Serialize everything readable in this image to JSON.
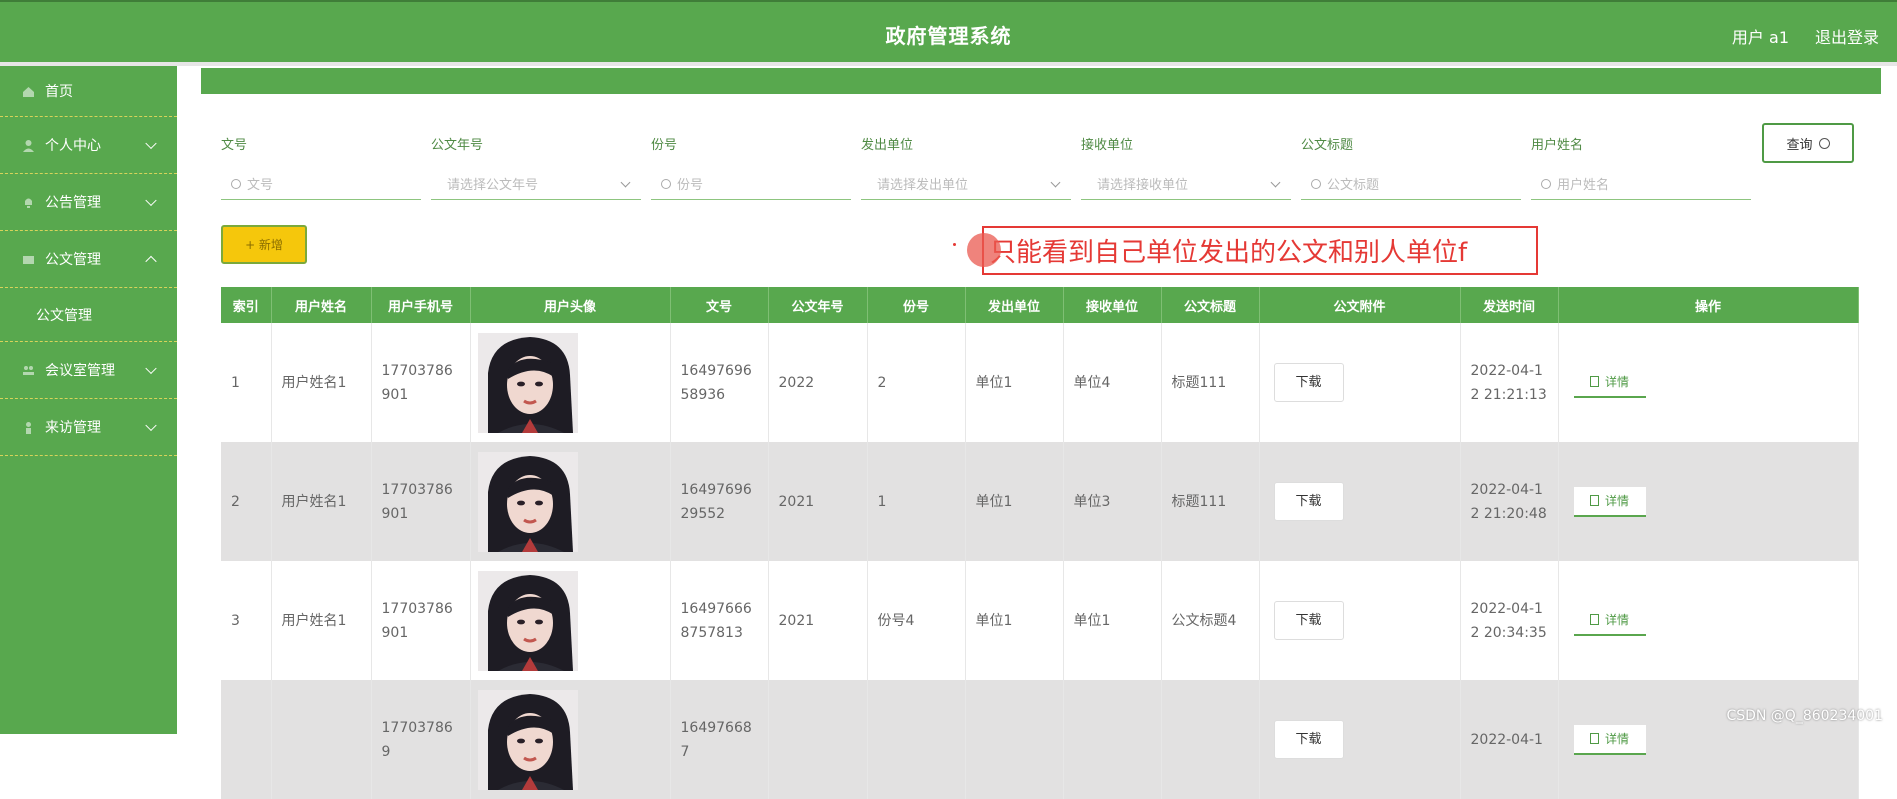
{
  "header": {
    "title": "政府管理系统",
    "user": "用户 a1",
    "logout": "退出登录"
  },
  "sidebar": {
    "items": [
      {
        "label": "首页"
      },
      {
        "label": "个人中心"
      },
      {
        "label": "公告管理"
      },
      {
        "label": "公文管理"
      },
      {
        "label": "公文管理"
      },
      {
        "label": "会议室管理"
      },
      {
        "label": "来访管理"
      }
    ]
  },
  "filters": {
    "wenhao": {
      "label": "文号",
      "placeholder": "文号"
    },
    "year": {
      "label": "公文年号",
      "placeholder": "请选择公文年号"
    },
    "fenhao": {
      "label": "份号",
      "placeholder": "份号"
    },
    "sender": {
      "label": "发出单位",
      "placeholder": "请选择发出单位"
    },
    "receiver": {
      "label": "接收单位",
      "placeholder": "请选择接收单位"
    },
    "title": {
      "label": "公文标题",
      "placeholder": "公文标题"
    },
    "username": {
      "label": "用户姓名",
      "placeholder": "用户姓名"
    },
    "query": "查询",
    "add": "+ 新增"
  },
  "annotation": "只能看到自己单位发出的公文和别人单位f",
  "table": {
    "headers": [
      "索引",
      "用户姓名",
      "用户手机号",
      "用户头像",
      "文号",
      "公文年号",
      "份号",
      "发出单位",
      "接收单位",
      "公文标题",
      "公文附件",
      "发送时间",
      "操作"
    ],
    "download": "下载",
    "detail": "详情",
    "rows": [
      {
        "idx": "1",
        "name": "用户姓名1",
        "phone": "17703786901",
        "wenhao": "1649769658936",
        "year": "2022",
        "fenhao": "2",
        "sender": "单位1",
        "receiver": "单位4",
        "title": "标题111",
        "time": "2022-04-12 21:21:13"
      },
      {
        "idx": "2",
        "name": "用户姓名1",
        "phone": "17703786901",
        "wenhao": "1649769629552",
        "year": "2021",
        "fenhao": "1",
        "sender": "单位1",
        "receiver": "单位3",
        "title": "标题111",
        "time": "2022-04-12 21:20:48"
      },
      {
        "idx": "3",
        "name": "用户姓名1",
        "phone": "17703786901",
        "wenhao": "164976668757813",
        "year": "2021",
        "fenhao": "份号4",
        "sender": "单位1",
        "receiver": "单位1",
        "title": "公文标题4",
        "time": "2022-04-12 20:34:35"
      },
      {
        "idx": "",
        "name": "",
        "phone": "177037869",
        "wenhao": "164976687",
        "year": "",
        "fenhao": "",
        "sender": "",
        "receiver": "",
        "title": "",
        "time": "2022-04-1"
      }
    ]
  },
  "watermark": "CSDN @Q_860234001"
}
